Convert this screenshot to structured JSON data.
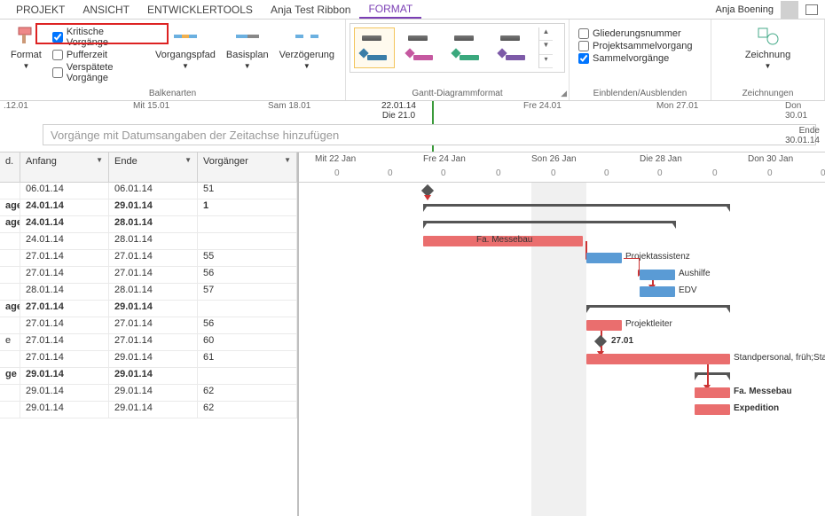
{
  "tabs": {
    "projekt": "PROJEKT",
    "ansicht": "ANSICHT",
    "entwicklertools": "ENTWICKLERTOOLS",
    "anja_ribbon": "Anja Test Ribbon",
    "format": "FORMAT"
  },
  "user": {
    "name": "Anja Boening"
  },
  "ribbon": {
    "format_btn": "Format",
    "kritische": "Kritische Vorgänge",
    "pufferzeit": "Pufferzeit",
    "verspaetete": "Verspätete Vorgänge",
    "balkenarten": "Balkenarten",
    "vorgangspfad": "Vorgangspfad",
    "basisplan": "Basisplan",
    "verzoegerung": "Verzögerung",
    "gantt_format": "Gantt-Diagrammformat",
    "gliederungsnummer": "Gliederungsnummer",
    "projektsammelvorgang": "Projektsammelvorgang",
    "sammelvorgaenge": "Sammelvorgänge",
    "einblenden": "Einblenden/Ausblenden",
    "zeichnung": "Zeichnung",
    "zeichnungen": "Zeichnungen"
  },
  "timeline": {
    "d1": ".12.01",
    "d2": "Mit 15.01",
    "d3": "Sam 18.01",
    "today_top": "22.01.14",
    "today_bot": "Die 21.0",
    "d4": "Fre 24.01",
    "d5": "Mon 27.01",
    "d6": "Don 30.01",
    "placeholder": "Vorgänge mit Datumsangaben der Zeitachse hinzufügen",
    "ende_lbl": "Ende",
    "ende_date": "30.01.14"
  },
  "grid": {
    "col_d": "d.",
    "col_anfang": "Anfang",
    "col_ende": "Ende",
    "col_vorgaenger": "Vorgänger"
  },
  "rows": [
    {
      "d": "",
      "anf": "06.01.14",
      "end": "06.01.14",
      "vor": "51",
      "bold": false
    },
    {
      "d": "age",
      "anf": "24.01.14",
      "end": "29.01.14",
      "vor": "1",
      "bold": true
    },
    {
      "d": "age",
      "anf": "24.01.14",
      "end": "28.01.14",
      "vor": "",
      "bold": true
    },
    {
      "d": "",
      "anf": "24.01.14",
      "end": "28.01.14",
      "vor": "",
      "bold": false
    },
    {
      "d": "",
      "anf": "27.01.14",
      "end": "27.01.14",
      "vor": "55",
      "bold": false
    },
    {
      "d": "",
      "anf": "27.01.14",
      "end": "27.01.14",
      "vor": "56",
      "bold": false
    },
    {
      "d": "",
      "anf": "28.01.14",
      "end": "28.01.14",
      "vor": "57",
      "bold": false
    },
    {
      "d": "age",
      "anf": "27.01.14",
      "end": "29.01.14",
      "vor": "",
      "bold": true
    },
    {
      "d": "",
      "anf": "27.01.14",
      "end": "27.01.14",
      "vor": "56",
      "bold": false
    },
    {
      "d": "e",
      "anf": "27.01.14",
      "end": "27.01.14",
      "vor": "60",
      "bold": false
    },
    {
      "d": "",
      "anf": "27.01.14",
      "end": "29.01.14",
      "vor": "61",
      "bold": false
    },
    {
      "d": "ge",
      "anf": "29.01.14",
      "end": "29.01.14",
      "vor": "",
      "bold": true
    },
    {
      "d": "",
      "anf": "29.01.14",
      "end": "29.01.14",
      "vor": "62",
      "bold": false
    },
    {
      "d": "",
      "anf": "29.01.14",
      "end": "29.01.14",
      "vor": "62",
      "bold": false
    }
  ],
  "chart": {
    "dates": [
      "Mit 22 Jan",
      "Fre 24 Jan",
      "Son 26 Jan",
      "Die 28 Jan",
      "Don 30 Jan"
    ],
    "labels": {
      "messebau": "Fa. Messebau",
      "projektassistenz": "Projektassistenz",
      "aushilfe": "Aushilfe",
      "edv": "EDV",
      "projektleiter": "Projektleiter",
      "m2701": "27.01",
      "standpersonal": "Standpersonal, früh;Star",
      "messebau2": "Fa. Messebau",
      "expedition": "Expedition"
    }
  },
  "chart_data": {
    "type": "gantt",
    "tasks": [
      {
        "row": 1,
        "kind": "milestone",
        "date": "24.01"
      },
      {
        "row": 2,
        "kind": "summary",
        "start": "24.01",
        "end": "29.01"
      },
      {
        "row": 3,
        "kind": "summary",
        "start": "24.01",
        "end": "28.01"
      },
      {
        "row": 4,
        "kind": "bar",
        "color": "red",
        "start": "24.01",
        "end": "28.01",
        "label": "Fa. Messebau"
      },
      {
        "row": 5,
        "kind": "bar",
        "color": "blue",
        "start": "27.01",
        "end": "27.01",
        "label": "Projektassistenz"
      },
      {
        "row": 6,
        "kind": "bar",
        "color": "blue",
        "start": "27.01",
        "end": "27.01",
        "label": "Aushilfe"
      },
      {
        "row": 7,
        "kind": "bar",
        "color": "blue",
        "start": "28.01",
        "end": "28.01",
        "label": "EDV"
      },
      {
        "row": 8,
        "kind": "summary",
        "start": "27.01",
        "end": "29.01"
      },
      {
        "row": 9,
        "kind": "bar",
        "color": "red",
        "start": "27.01",
        "end": "27.01",
        "label": "Projektleiter"
      },
      {
        "row": 10,
        "kind": "milestone",
        "date": "27.01",
        "label": "27.01"
      },
      {
        "row": 11,
        "kind": "bar",
        "color": "red",
        "start": "27.01",
        "end": "29.01",
        "label": "Standpersonal, früh;Star"
      },
      {
        "row": 12,
        "kind": "summary",
        "start": "29.01",
        "end": "29.01"
      },
      {
        "row": 13,
        "kind": "bar",
        "color": "red",
        "start": "29.01",
        "end": "29.01",
        "label": "Fa. Messebau"
      },
      {
        "row": 14,
        "kind": "bar",
        "color": "red",
        "start": "29.01",
        "end": "29.01",
        "label": "Expedition"
      }
    ]
  }
}
